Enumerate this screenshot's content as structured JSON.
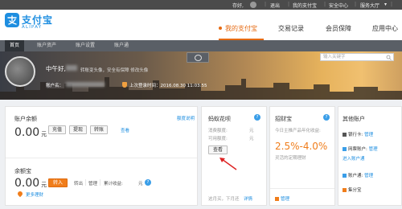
{
  "topbar": {
    "greeting": "存好,",
    "logout": "退出",
    "my_alipay": "我的支付宝",
    "security_center": "安全中心",
    "service_center": "服务大厅"
  },
  "header": {
    "logo_text": "支付宝",
    "logo_sub": "ALIPAY",
    "nav": [
      "我的支付宝",
      "交易记录",
      "会员保障",
      "应用中心"
    ]
  },
  "subnav": {
    "tabs": [
      "首页",
      "账户资产",
      "账户设置",
      "账户通"
    ]
  },
  "search": {
    "placeholder": "输入关键字"
  },
  "banner": {
    "greeting": "中午好,",
    "greeting_sub": "转账变头像，安全有保障 修改头像",
    "acct_label": "账户名：",
    "last_login": "上次登录时间：2016.08.30 11:03:55"
  },
  "balance": {
    "title": "账户余额",
    "amount": "0.00",
    "unit": "元",
    "buttons": [
      "充值",
      "提现",
      "转账"
    ],
    "view_link": "查看",
    "safety_link": "额度说明"
  },
  "yuebao": {
    "title": "余额宝",
    "amount": "0.00",
    "unit": "元",
    "transfer_in": "转入",
    "transfer_out": "转出",
    "manage": "管理",
    "cumulative": "累计收益:",
    "cum_unit": "元",
    "more": "更多理财"
  },
  "huabei": {
    "title": "蚂蚁花呗",
    "available_label": "消费额度:",
    "available_unit": "元",
    "usable_label": "可用额度:",
    "usable_unit": "元",
    "view_btn": "查看",
    "footer": "这月买，下月还",
    "footer_link": "详情"
  },
  "zhaocaibao": {
    "title": "招财宝",
    "desc": "今日主推产品年化收益:",
    "rate": "2.5%-4.0%",
    "sub": "灵活的定期理财",
    "manage": "管理"
  },
  "other": {
    "title": "其他账户",
    "items": [
      {
        "label": "银行卡:",
        "link": "管理"
      },
      {
        "label": "网票账户:",
        "link": "管理"
      },
      {
        "label": "进入账户通",
        "link": ""
      },
      {
        "label": "账户通:",
        "link": "管理"
      },
      {
        "label": "集分宝",
        "link": ""
      }
    ]
  },
  "colors": {
    "accent": "#e66a12",
    "brand": "#1e8ee0",
    "orange_btn": "#f07d1b"
  }
}
